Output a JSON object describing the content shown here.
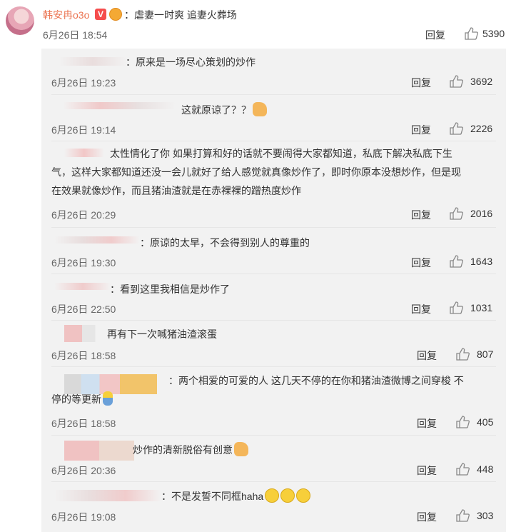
{
  "main_comment": {
    "author": "韩安冉o3o",
    "vip_badge": "V",
    "text": "：虐妻一时爽 追妻火葬场",
    "time": "6月26日 18:54",
    "reply_label": "回复",
    "likes": "5390"
  },
  "replies": [
    {
      "text": "：原来是一场尽心策划的炒作",
      "time": "6月26日 19:23",
      "reply_label": "回复",
      "likes": "3692",
      "emoji": ""
    },
    {
      "text": "这就原谅了？？",
      "time": "6月26日 19:14",
      "reply_label": "回复",
      "likes": "2226",
      "emoji": "thumbs-up"
    },
    {
      "text_lines": [
        "太性情化了你  如果打算和好的话就不要闹得大家都知道，私底下解决私底下生",
        "气，这样大家都知道还没一会儿就好了给人感觉就真像炒作了，即时你原本没想炒作，但是现",
        "在效果就像炒作，而且猪油渣就是在赤裸裸的蹭热度炒作"
      ],
      "time": "6月26日 20:29",
      "reply_label": "回复",
      "likes": "2016"
    },
    {
      "text": "：原谅的太早，不会得到别人的尊重的",
      "time": "6月26日 19:30",
      "reply_label": "回复",
      "likes": "1643"
    },
    {
      "text": "：看到这里我相信是炒作了",
      "time": "6月26日 22:50",
      "reply_label": "回复",
      "likes": "1031"
    },
    {
      "text": "再有下一次喊猪油渣滚蛋",
      "time": "6月26日 18:58",
      "reply_label": "回复",
      "likes": "807"
    },
    {
      "text_lines": [
        "：两个相爱的可爱的人  这几天不停的在你和猪油渣微博之间穿梭 不",
        "停的等更新"
      ],
      "time": "6月26日 18:58",
      "reply_label": "回复",
      "likes": "405",
      "emoji": "figure"
    },
    {
      "text": "炒作的清新脱俗有创意",
      "time": "6月26日 20:36",
      "reply_label": "回复",
      "likes": "448",
      "emoji": "thumbs-up"
    },
    {
      "text": "：不是发誓不同框haha",
      "time": "6月26日 19:08",
      "reply_label": "回复",
      "likes": "303",
      "emoji": "crying-x3"
    }
  ],
  "colors": {
    "author": "#eb7350",
    "reply_bg": "#f2f2f2",
    "text": "#333333",
    "time": "#666666"
  },
  "icons": {
    "like": "thumbs-up-outline-icon",
    "vip": "vip-badge-icon",
    "medal": "medal-icon"
  }
}
